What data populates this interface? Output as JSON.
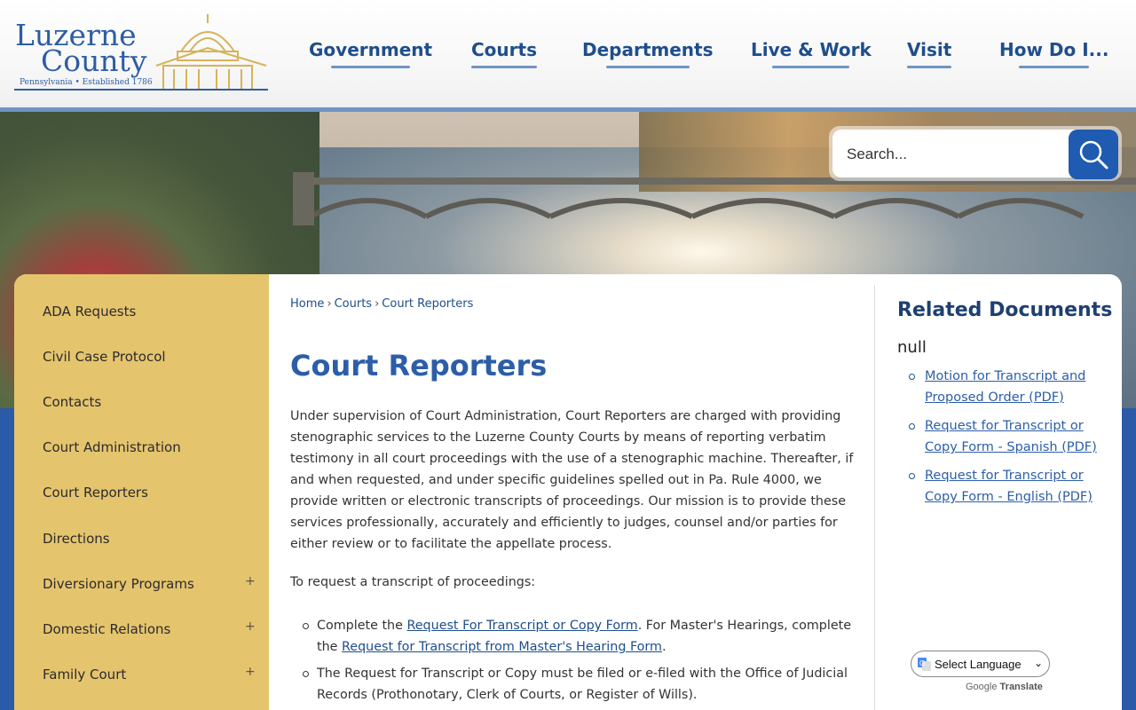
{
  "logo": {
    "line1": "Luzerne",
    "line2": "County",
    "tagline": "Pennsylvania • Established 1786"
  },
  "nav": [
    {
      "label": "Government"
    },
    {
      "label": "Courts"
    },
    {
      "label": "Departments"
    },
    {
      "label": "Live & Work"
    },
    {
      "label": "Visit"
    },
    {
      "label": "How Do I..."
    }
  ],
  "search": {
    "placeholder": "Search..."
  },
  "sidebar": {
    "items": [
      {
        "label": "ADA Requests",
        "expandable": false
      },
      {
        "label": "Civil Case Protocol",
        "expandable": false
      },
      {
        "label": "Contacts",
        "expandable": false
      },
      {
        "label": "Court Administration",
        "expandable": false
      },
      {
        "label": "Court Reporters",
        "expandable": false
      },
      {
        "label": "Directions",
        "expandable": false
      },
      {
        "label": "Diversionary Programs",
        "expandable": true
      },
      {
        "label": "Domestic Relations",
        "expandable": true
      },
      {
        "label": "Family Court",
        "expandable": true
      }
    ],
    "expand_symbol": "+"
  },
  "breadcrumb": {
    "items": [
      "Home",
      "Courts",
      "Court Reporters"
    ],
    "separator": "›"
  },
  "page": {
    "title": "Court Reporters",
    "intro": "Under supervision of Court Administration, Court Reporters are charged with providing stenographic services to the Luzerne County Courts by means of reporting verbatim testimony in all court proceedings with the use of a stenographic machine.  Thereafter, if and when requested, and under specific guidelines spelled out in Pa. Rule 4000, we provide written or electronic transcripts of proceedings.  Our mission is to provide these services professionally, accurately and efficiently to judges, counsel and/or parties for either review or to facilitate the appellate process.",
    "request_heading": "To request a transcript of proceedings:",
    "steps": [
      {
        "pre": "Complete the ",
        "link1": "Request For Transcript or Copy Form",
        "mid": ". For Master's Hearings, complete the ",
        "link2": "Request for Transcript from Master's Hearing Form",
        "post": "."
      },
      {
        "text": "The Request for Transcript or Copy must be filed or e-filed with the Office of Judicial Records (Prothonotary, Clerk of Courts, or Register of Wills)."
      }
    ]
  },
  "related": {
    "title": "Related Documents",
    "group_label": "null",
    "documents": [
      {
        "label": "Motion for Transcript and Proposed Order (PDF)"
      },
      {
        "label": "Request for Transcript or Copy Form - Spanish (PDF)"
      },
      {
        "label": "Request for Transcript or Copy Form - English (PDF)"
      }
    ]
  },
  "translate": {
    "select_label": "Select Language",
    "powered_google": "Google",
    "powered_translate": "Translate"
  },
  "colors": {
    "brand_blue": "#2c5ea8",
    "nav_blue": "#1e4e8c",
    "sidebar_gold": "#e5c46e",
    "search_button": "#1f5bb0",
    "page_background": "#2a5aa8"
  }
}
